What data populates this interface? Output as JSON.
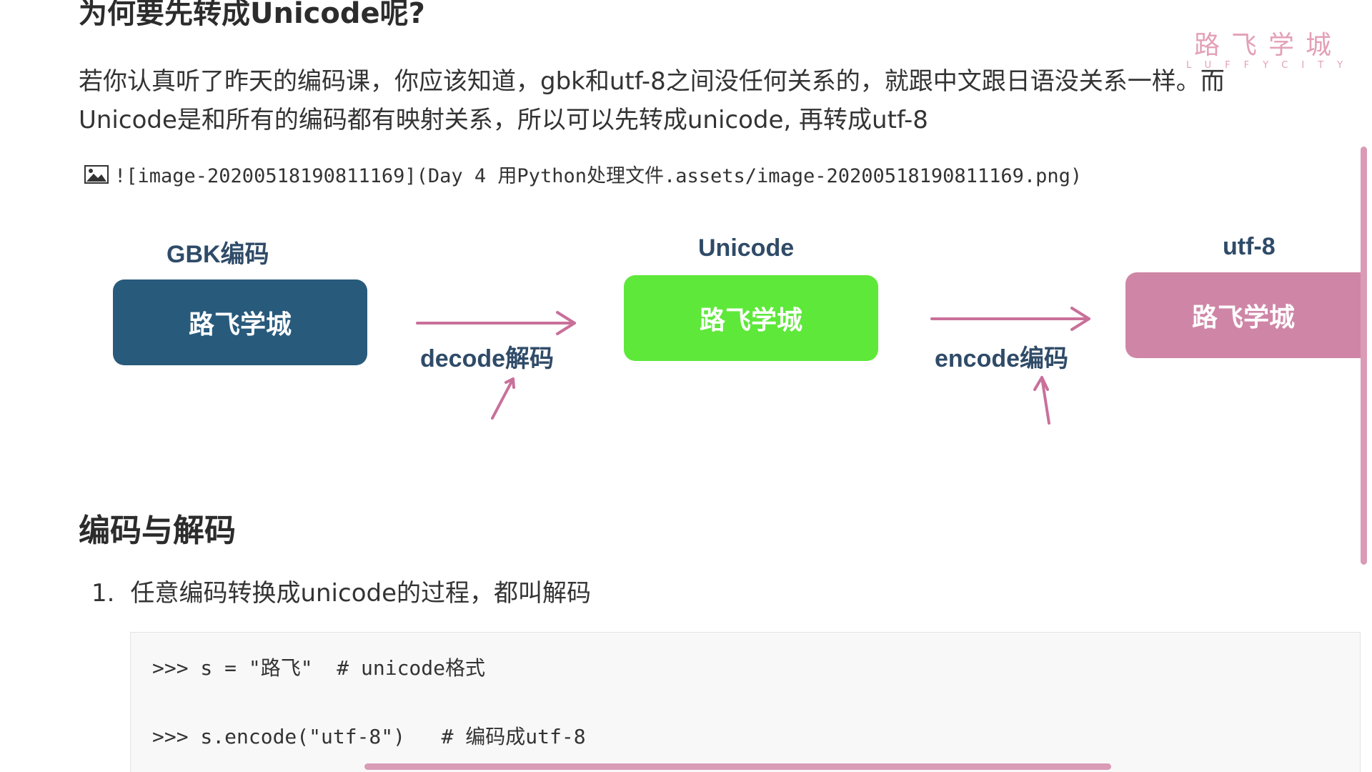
{
  "document": {
    "heading_top": "为何要先转成Unicode呢?",
    "paragraph_line1": "若你认真听了昨天的编码课，你应该知道，gbk和utf-8之间没任何关系的，就跟中文跟日语没关系一样。而",
    "paragraph_line2": "Unicode是和所有的编码都有映射关系，所以可以先转成unicode, 再转成utf-8",
    "image_markdown": "![image-20200518190811169](Day 4 用Python处理文件.assets/image-20200518190811169.png)",
    "section_heading": "编码与解码",
    "list_number": "1.",
    "list_item": "任意编码转换成unicode的过程，都叫解码",
    "code_lines": [
      ">>> s = \"路飞\"  # unicode格式",
      ">>> s.encode(\"utf-8\")   # 编码成utf-8"
    ]
  },
  "watermark": {
    "cn": "路飞学城",
    "en": "LUFFYCITY"
  },
  "diagram": {
    "gbk_label": "GBK编码",
    "unicode_label": "Unicode",
    "utf8_label": "utf-8",
    "box_text": "路飞学城",
    "decode_label": "decode解码",
    "encode_label": "encode编码",
    "colors": {
      "gbk_box": "#285a7c",
      "unicode_box": "#5ee83a",
      "utf8_box": "#cf86a6",
      "arrow": "#c9709a"
    }
  }
}
